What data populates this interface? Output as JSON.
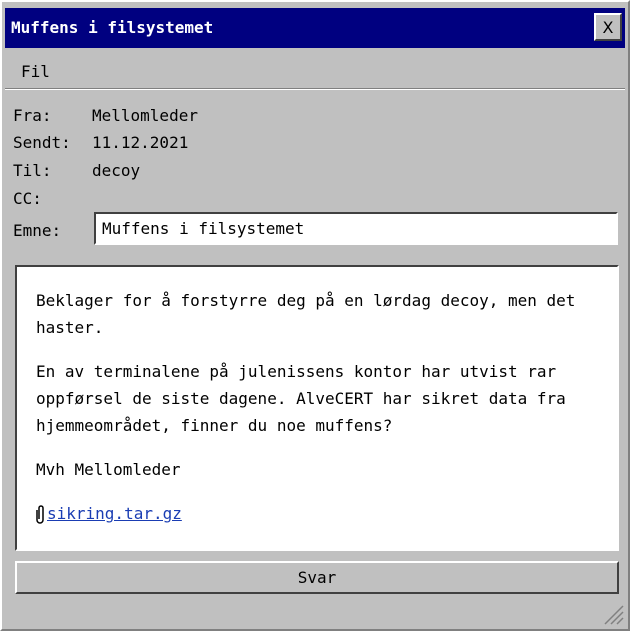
{
  "window": {
    "title": "Muffens i filsystemet",
    "close_label": "X"
  },
  "menu": {
    "items": [
      "Fil"
    ]
  },
  "headers": [
    {
      "label": "Fra:",
      "value": "Mellomleder"
    },
    {
      "label": "Sendt:",
      "value": "11.12.2021"
    },
    {
      "label": "Til:",
      "value": "decoy"
    },
    {
      "label": "CC:",
      "value": ""
    }
  ],
  "subject": {
    "label": "Emne:",
    "value": "Muffens i filsystemet"
  },
  "message": {
    "paragraphs": [
      "Beklager for å forstyrre deg på en lørdag decoy, men det haster.",
      "En av terminalene på julenissens kontor har utvist rar oppførsel de siste dagene. AlveCERT har sikret data fra hjemmeområdet, finner du noe muffens?",
      "Mvh Mellomleder"
    ],
    "attachment": {
      "icon": "paperclip-icon",
      "filename": "sikring.tar.gz"
    }
  },
  "actions": {
    "reply_label": "Svar"
  },
  "colors": {
    "titlebar": "#000080",
    "window": "#c0c0c0",
    "link": "#1a3db3"
  }
}
